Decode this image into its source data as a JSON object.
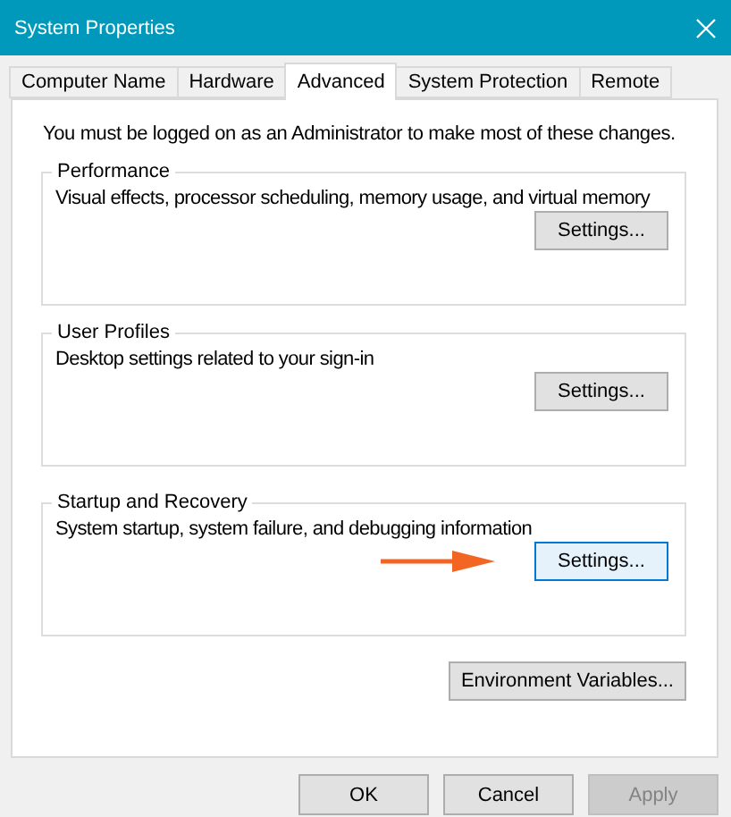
{
  "window": {
    "title": "System Properties"
  },
  "tabs": [
    {
      "label": "Computer Name",
      "selected": false
    },
    {
      "label": "Hardware",
      "selected": false
    },
    {
      "label": "Advanced",
      "selected": true
    },
    {
      "label": "System Protection",
      "selected": false
    },
    {
      "label": "Remote",
      "selected": false
    }
  ],
  "notice": "You must be logged on as an Administrator to make most of these changes.",
  "groups": [
    {
      "title": "Performance",
      "description": "Visual effects, processor scheduling, memory usage, and virtual memory",
      "button": "Settings...",
      "focused": false
    },
    {
      "title": "User Profiles",
      "description": "Desktop settings related to your sign-in",
      "button": "Settings...",
      "focused": false
    },
    {
      "title": "Startup and Recovery",
      "description": "System startup, system failure, and debugging information",
      "button": "Settings...",
      "focused": true
    }
  ],
  "environment_button": "Environment Variables...",
  "buttons": [
    {
      "label": "OK",
      "disabled": false
    },
    {
      "label": "Cancel",
      "disabled": false
    },
    {
      "label": "Apply",
      "disabled": true
    }
  ]
}
